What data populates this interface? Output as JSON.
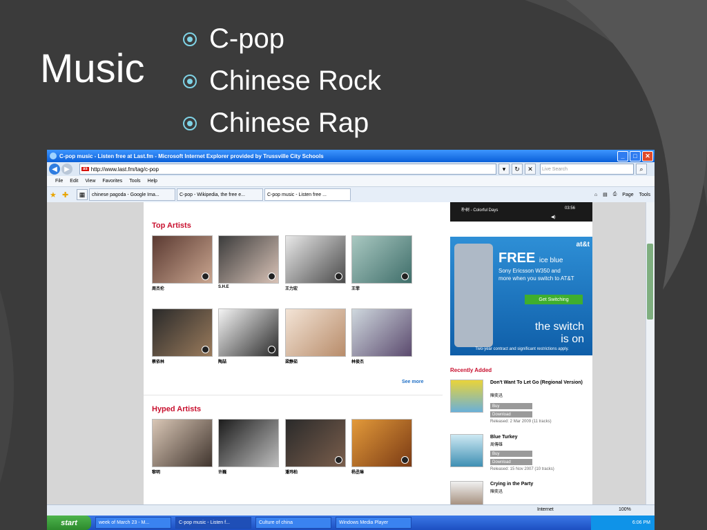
{
  "slide": {
    "title": "Music",
    "bullets": [
      "C-pop",
      "Chinese Rock",
      "Chinese Rap"
    ]
  },
  "browser": {
    "window_title": "C-pop music - Listen free at Last.fm - Microsoft Internet Explorer provided by Trussville City Schools",
    "address": "http://www.last.fm/tag/c-pop",
    "search_placeholder": "Live Search",
    "menu": [
      "File",
      "Edit",
      "View",
      "Favorites",
      "Tools",
      "Help"
    ],
    "tabs": [
      {
        "label": "chinese pagoda - Google Ima..."
      },
      {
        "label": "C-pop - Wikipedia, the free e..."
      },
      {
        "label": "C-pop music - Listen free ..."
      }
    ],
    "tools": {
      "page": "Page",
      "tools": "Tools"
    },
    "favicon_lastfm": "as"
  },
  "page": {
    "player": {
      "track": "朴树 - Colorful Days",
      "time": "03:56"
    },
    "top_artists_heading": "Top Artists",
    "top_artists": [
      "周杰伦",
      "S.H.E",
      "王力宏",
      "王菲",
      "蔡依林",
      "陶喆",
      "梁静茹",
      "林俊杰"
    ],
    "see_more": "See more",
    "hyped_artists_heading": "Hyped Artists",
    "hyped_artists": [
      "黎明",
      "许巍",
      "潘玮柏",
      "杨丞琳"
    ],
    "ad": {
      "brand": "at&t",
      "free": "FREE",
      "free_suffix": "ice blue",
      "line1": "Sony Ericsson W350 and",
      "line2": "more when you switch to AT&T",
      "button": "Get Switching",
      "tagline1": "the switch",
      "tagline2": "is on",
      "fine_print": "Two-year contract and significant restrictions apply."
    },
    "recently_added_heading": "Recently Added",
    "albums": [
      {
        "title": "Don't Want To Let Go (Regional Version)",
        "artist": "陳奕迅",
        "buy": "Buy",
        "download": "Download",
        "released": "Released: 2 Mar 2009 (11 tracks)"
      },
      {
        "title": "Blue Turkey",
        "artist": "周傳雄",
        "buy": "Buy",
        "download": "Download",
        "released": "Released: 15 Nov 2007 (10 tracks)"
      },
      {
        "title": "Crying in the Party",
        "artist": "陳奕迅"
      }
    ]
  },
  "status": {
    "zone": "Internet",
    "zoom": "100%"
  },
  "taskbar": {
    "start": "start",
    "items": [
      "week of March 23 - M...",
      "C-pop music - Listen f...",
      "Culture of china",
      "Windows Media Player"
    ],
    "clock": "6:06 PM"
  },
  "colors": {
    "accent_red": "#c8102e",
    "ie_blue": "#0a5fd8",
    "bullet": "#7fd3e6"
  }
}
